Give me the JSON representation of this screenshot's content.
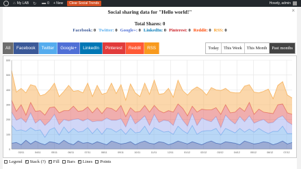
{
  "admin_bar": {
    "site_name": "My LAB",
    "comments_count": "0",
    "new_label": "+ New",
    "highlight_label": "Clear Social Trends",
    "howdy": "Howdy, admin"
  },
  "panel": {
    "title": "Social sharing data for \"Hello world!\"",
    "total": "Total Shares: 0",
    "networks": [
      {
        "label": "Facebook:",
        "count": "0",
        "color": "#3b5998"
      },
      {
        "label": "Twitter:",
        "count": "0",
        "color": "#55acee"
      },
      {
        "label": "Google+:",
        "count": "0",
        "color": "#4f6fd6"
      },
      {
        "label": "LinkedIn:",
        "count": "0",
        "color": "#0077b5"
      },
      {
        "label": "Pinterest:",
        "count": "0",
        "color": "#cb2027"
      },
      {
        "label": "Reddit:",
        "count": "0",
        "color": "#ff4500"
      },
      {
        "label": "RSS:",
        "count": "0",
        "color": "#f89a1e"
      }
    ]
  },
  "filters": {
    "networks": [
      {
        "label": "All",
        "color": "#6d6d6d"
      },
      {
        "label": "Facebook",
        "color": "#3b5998"
      },
      {
        "label": "Twitter",
        "color": "#55acee"
      },
      {
        "label": "Google+",
        "color": "#4f6fd6"
      },
      {
        "label": "LinkedIn",
        "color": "#0077b5"
      },
      {
        "label": "Pinterest",
        "color": "#e13b3b"
      },
      {
        "label": "Reddit",
        "color": "#ff5a36"
      },
      {
        "label": "RSS",
        "color": "#f89a1e"
      }
    ],
    "ranges": [
      "Today",
      "This Week",
      "This Month",
      "Past months"
    ],
    "active_range": "Past months"
  },
  "options": [
    {
      "label": "Legend",
      "checked": false
    },
    {
      "label": "Stack (?)",
      "checked": true
    },
    {
      "label": "Fill",
      "checked": true
    },
    {
      "label": "Bars",
      "checked": false
    },
    {
      "label": "Lines",
      "checked": true
    },
    {
      "label": "Points",
      "checked": false
    }
  ],
  "chart_data": {
    "type": "area",
    "stacked": true,
    "grid": true,
    "y_ticks": [
      "0",
      "100",
      "200",
      "300",
      "400",
      "500",
      "600"
    ],
    "x_ticks": [
      "03/11",
      "04/11",
      "05/11",
      "06/11",
      "07/11",
      "08/11",
      "09/11",
      "10/11",
      "11/11",
      "12/11",
      "01/12",
      "02/12",
      "03/12",
      "04/12",
      "05/12",
      "06/12",
      "07/12"
    ],
    "ylim": [
      0,
      600
    ],
    "series": [
      {
        "color": "#4c67b0",
        "values": [
          40,
          45,
          30,
          60,
          35,
          55,
          40,
          30,
          50,
          45,
          35,
          60,
          40,
          30,
          55,
          40,
          45,
          35,
          50,
          40,
          30,
          55,
          45,
          35,
          40,
          50,
          30,
          45,
          55,
          40,
          35,
          50,
          45,
          30,
          40,
          55,
          45,
          35,
          50,
          40,
          30,
          45,
          55,
          40,
          35,
          50,
          45,
          40,
          30,
          55,
          45,
          35,
          40,
          50,
          45,
          30,
          40,
          55,
          35,
          45
        ]
      },
      {
        "color": "#7fb6ee",
        "values": [
          120,
          80,
          100,
          60,
          110,
          70,
          90,
          50,
          80,
          100,
          60,
          90,
          70,
          110,
          60,
          80,
          100,
          70,
          90,
          60,
          110,
          80,
          70,
          100,
          60,
          90,
          80,
          70,
          100,
          60,
          110,
          80,
          70,
          90,
          60,
          100,
          80,
          70,
          110,
          60,
          90,
          80,
          70,
          100,
          60,
          90,
          80,
          70,
          110,
          60,
          90,
          80,
          100,
          70,
          60,
          90,
          80,
          100,
          70,
          60
        ]
      },
      {
        "color": "#a9b5f0",
        "values": [
          90,
          70,
          80,
          60,
          100,
          50,
          70,
          80,
          60,
          90,
          70,
          50,
          80,
          60,
          90,
          70,
          60,
          80,
          50,
          90,
          70,
          60,
          80,
          70,
          50,
          90,
          60,
          80,
          70,
          60,
          90,
          50,
          80,
          70,
          60,
          90,
          70,
          50,
          80,
          60,
          90,
          70,
          60,
          80,
          50,
          90,
          70,
          60,
          80,
          70,
          90,
          60,
          50,
          80,
          70,
          60,
          90,
          70,
          80,
          60
        ]
      },
      {
        "color": "#e36b6b",
        "values": [
          80,
          60,
          90,
          50,
          70,
          80,
          60,
          70,
          90,
          50,
          80,
          60,
          70,
          90,
          50,
          70,
          80,
          60,
          90,
          50,
          70,
          80,
          60,
          90,
          70,
          50,
          80,
          60,
          70,
          90,
          60,
          80,
          50,
          70,
          90,
          60,
          80,
          70,
          50,
          90,
          60,
          70,
          80,
          60,
          90,
          70,
          50,
          80,
          60,
          70,
          90,
          60,
          80,
          50,
          70,
          60,
          90,
          80,
          60,
          70
        ]
      },
      {
        "color": "#f7b766",
        "values": [
          200,
          130,
          110,
          150,
          120,
          170,
          100,
          140,
          120,
          160,
          110,
          130,
          170,
          100,
          140,
          120,
          160,
          110,
          150,
          130,
          100,
          170,
          120,
          140,
          110,
          160,
          130,
          100,
          150,
          120,
          170,
          110,
          130,
          150,
          100,
          160,
          120,
          140,
          110,
          170,
          130,
          100,
          150,
          120,
          160,
          110,
          140,
          130,
          100,
          170,
          120,
          150,
          110,
          140,
          160,
          100,
          130,
          150,
          120,
          110
        ]
      }
    ]
  }
}
